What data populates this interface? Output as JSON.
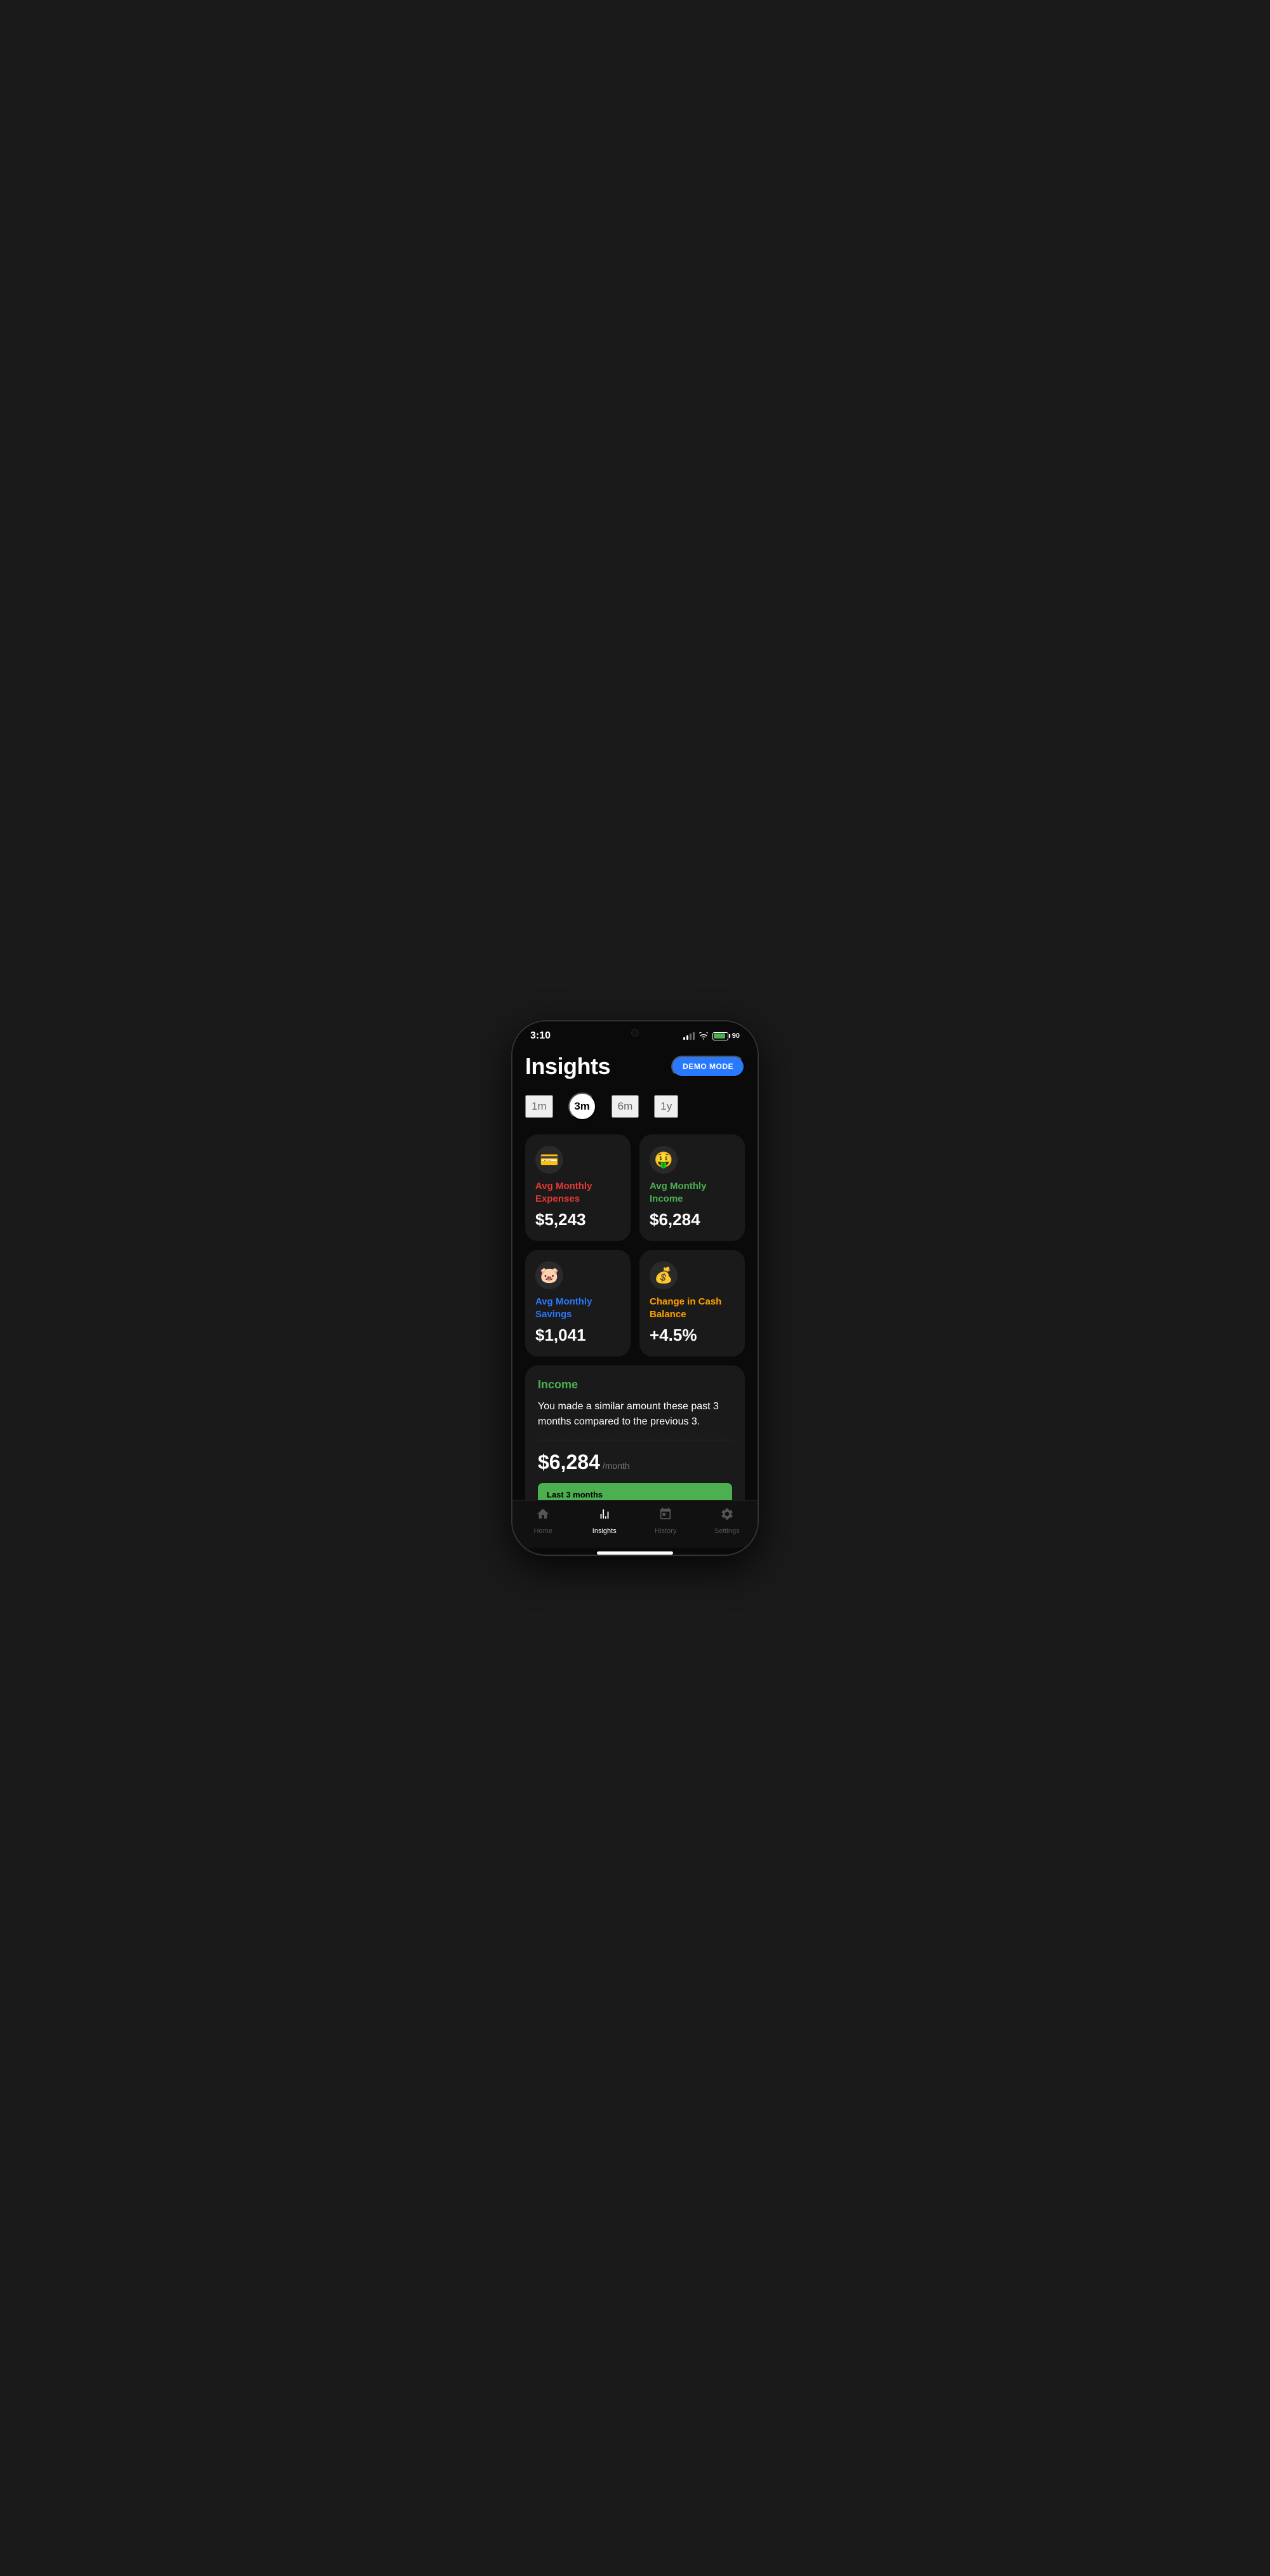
{
  "statusBar": {
    "time": "3:10",
    "battery": "90"
  },
  "header": {
    "title": "Insights",
    "demoBadge": "DEMO MODE"
  },
  "timeTabs": [
    {
      "label": "1m",
      "active": false
    },
    {
      "label": "3m",
      "active": true
    },
    {
      "label": "6m",
      "active": false
    },
    {
      "label": "1y",
      "active": false
    }
  ],
  "cards": [
    {
      "icon": "💳",
      "label": "Avg Monthly Expenses",
      "labelColor": "red",
      "value": "$5,243"
    },
    {
      "icon": "🤑",
      "label": "Avg Monthly Income",
      "labelColor": "green",
      "value": "$6,284"
    },
    {
      "icon": "🐷",
      "label": "Avg Monthly Savings",
      "labelColor": "blue",
      "value": "$1,041"
    },
    {
      "icon": "💰",
      "label": "Change in Cash Balance",
      "labelColor": "gold",
      "value": "+4.5%"
    }
  ],
  "incomeCard": {
    "title": "Income",
    "description": "You made a similar amount these past 3 months compared to the previous 3.",
    "amount": "$6,284",
    "period": "/month",
    "barLabel": "Last 3 months"
  },
  "bottomNav": [
    {
      "icon": "home",
      "label": "Home",
      "active": false
    },
    {
      "icon": "insights",
      "label": "Insights",
      "active": true
    },
    {
      "icon": "history",
      "label": "History",
      "active": false
    },
    {
      "icon": "settings",
      "label": "Settings",
      "active": false
    }
  ]
}
